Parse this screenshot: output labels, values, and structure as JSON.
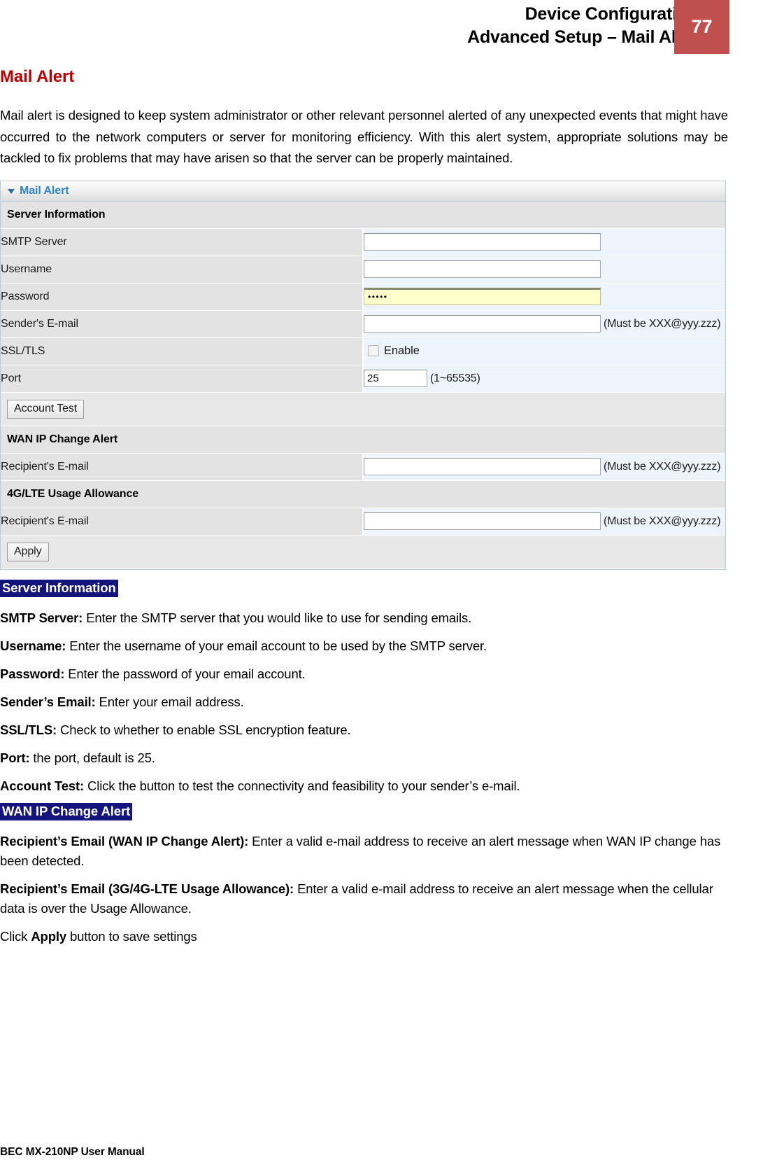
{
  "header": {
    "title_line1": "Device Configuration",
    "title_line2": "Advanced Setup – Mail Alert",
    "page_number": "77",
    "badge_color": "#c0504d"
  },
  "section": {
    "title": "Mail Alert",
    "title_color": "#c00000",
    "intro": "Mail alert is designed to keep system administrator or other relevant personnel alerted of any unexpected events that might have occurred to the network computers or server for monitoring efficiency. With this alert system, appropriate solutions may be tackled to fix problems that may have arisen so that the server can be properly maintained."
  },
  "panel": {
    "header_label": "Mail Alert",
    "header_icon": "triangle-down-icon",
    "header_color": "#2e86c8",
    "groups": {
      "server_information": "Server Information",
      "wan_ip_change_alert": "WAN IP Change Alert",
      "lte_usage_allowance": "4G/LTE Usage Allowance"
    },
    "rows": {
      "smtp_server": {
        "label": "SMTP Server",
        "value": ""
      },
      "username": {
        "label": "Username",
        "value": ""
      },
      "password": {
        "label": "Password",
        "value": "•••••"
      },
      "sender_email": {
        "label": "Sender's E-mail",
        "value": "",
        "hint": "(Must be XXX@yyy.zzz)"
      },
      "ssl_tls": {
        "label": "SSL/TLS",
        "checkbox_label": "Enable",
        "checked": false
      },
      "port": {
        "label": "Port",
        "value": "25",
        "hint": "(1~65535)"
      },
      "wan_recipient": {
        "label": "Recipient's E-mail",
        "value": "",
        "hint": "(Must be XXX@yyy.zzz)"
      },
      "lte_recipient": {
        "label": "Recipient's E-mail",
        "value": "",
        "hint": "(Must be XXX@yyy.zzz)"
      }
    },
    "buttons": {
      "account_test": "Account Test",
      "apply": "Apply"
    }
  },
  "descriptions": {
    "heading_server_information": "Server Information",
    "heading_wan_ip_change_alert": "WAN IP Change Alert",
    "smtp_server_term": "SMTP Server:",
    "smtp_server_text": " Enter the SMTP server that you would like to use for sending emails.",
    "username_term": "Username:",
    "username_text": " Enter the username of your email account to be used by the SMTP server.",
    "password_term": "Password:",
    "password_text": " Enter the password of your email account.",
    "sender_email_term": "Sender’s Email:",
    "sender_email_text": " Enter your email address.",
    "ssl_tls_term": "SSL/TLS:",
    "ssl_tls_text": " Check to whether to enable SSL encryption feature.",
    "port_term": "Port:",
    "port_text": " the port, default is 25.",
    "account_test_term": "Account Test:",
    "account_test_text": " Click the button to test the connectivity and feasibility to your sender’s e-mail.",
    "wan_recipient_term": "Recipient’s Email (WAN IP Change Alert):",
    "wan_recipient_text": " Enter a valid e-mail address to receive an alert message when WAN IP change has been detected.",
    "lte_recipient_term": "Recipient’s Email (3G/4G-LTE Usage Allowance):",
    "lte_recipient_text": " Enter a valid e-mail address to receive an alert message when the cellular data is over the Usage Allowance.",
    "apply_prefix": "Click ",
    "apply_term": "Apply",
    "apply_suffix": " button to save settings"
  },
  "footer": {
    "text": "BEC MX-210NP User Manual"
  }
}
